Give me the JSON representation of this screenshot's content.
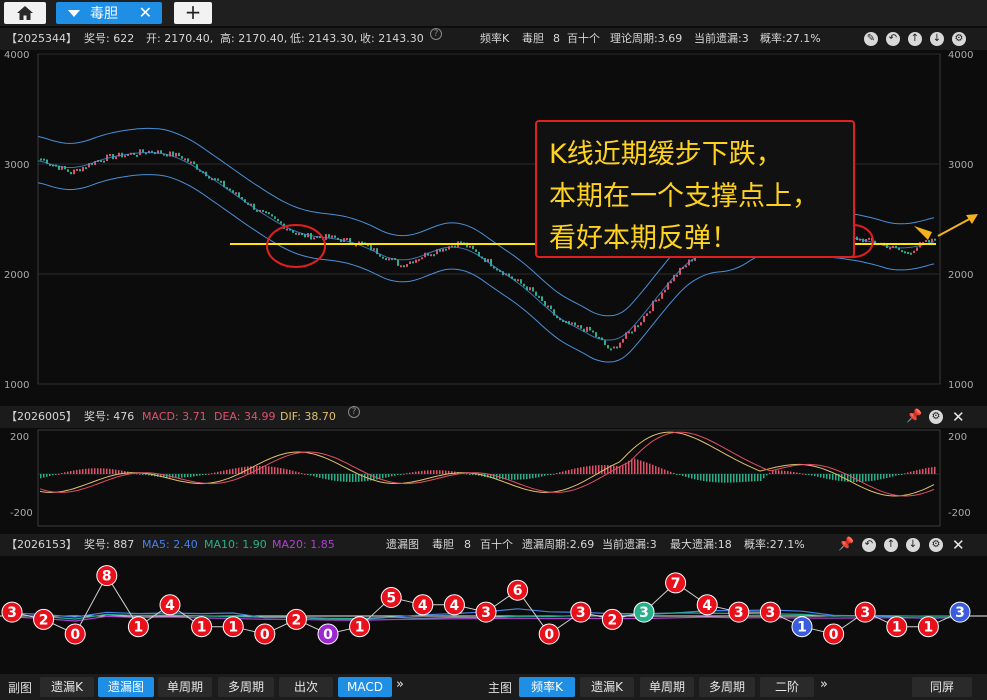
{
  "tabs": {
    "home_icon": "home-icon",
    "active_label": "毒胆",
    "close_glyph": "✕",
    "add_glyph": "+"
  },
  "main_panel": {
    "issue": "【2025344】",
    "award_no": "奖号: 622",
    "open": "开: 2170.40,",
    "high": "高: 2170.40,",
    "low": "低: 2143.30,",
    "close": "收: 2143.30",
    "help": "?",
    "mode": "频率K",
    "kind": "毒胆",
    "num": "8",
    "range": "百十个",
    "theory_cycle": "理论周期:3.69",
    "cur_miss": "当前遗漏:3",
    "prob": "概率:27.1%",
    "axis_labels": [
      "4000",
      "3000",
      "2000",
      "1000"
    ],
    "annotation_lines": [
      "K线近期缓步下跌，",
      "本期在一个支撑点上，",
      "看好本期反弹！"
    ],
    "colors": {
      "up": "#e0506a",
      "down": "#27b08a",
      "band": "#4a8fd8",
      "support": "#ffe600",
      "mark": "#e0201f",
      "arrow": "#f2b21c"
    }
  },
  "macd_panel": {
    "issue": "【2026005】",
    "award_no": "奖号: 476",
    "macd": "MACD: 3.71",
    "dea": "DEA: 34.99",
    "dif": "DIF: 38.70",
    "help": "?",
    "axis_labels": [
      "200",
      "-200"
    ]
  },
  "miss_panel": {
    "issue": "【2026153】",
    "award_no": "奖号: 887",
    "ma5": "MA5: 2.40",
    "ma10": "MA10: 1.90",
    "ma20": "MA20: 1.85",
    "chart_name": "遗漏图",
    "kind": "毒胆",
    "num": "8",
    "range": "百十个",
    "miss_cycle": "遗漏周期:2.69",
    "cur_miss": "当前遗漏:3",
    "max_miss": "最大遗漏:18",
    "prob": "概率:27.1%",
    "points": [
      3,
      2,
      0,
      8,
      1,
      4,
      1,
      1,
      0,
      2,
      0,
      1,
      5,
      4,
      4,
      3,
      6,
      0,
      3,
      2,
      3,
      7,
      4,
      3,
      3,
      1,
      0,
      3,
      1,
      1,
      3
    ],
    "colors": [
      "red",
      "red",
      "red",
      "red",
      "red",
      "red",
      "red",
      "red",
      "red",
      "red",
      "purple",
      "red",
      "red",
      "red",
      "red",
      "red",
      "red",
      "red",
      "red",
      "red",
      "green",
      "red",
      "red",
      "red",
      "red",
      "blue",
      "red",
      "red",
      "red",
      "red",
      "blue"
    ]
  },
  "bottom": {
    "sub_label": "副图",
    "sub_buttons": [
      "遗漏K",
      "遗漏图",
      "单周期",
      "多周期",
      "出次",
      "MACD"
    ],
    "sub_active": [
      1,
      5
    ],
    "more": "»",
    "main_label": "主图",
    "main_buttons": [
      "频率K",
      "遗漏K",
      "单周期",
      "多周期",
      "二阶"
    ],
    "main_active": [
      0
    ],
    "same_screen": "同屏"
  }
}
